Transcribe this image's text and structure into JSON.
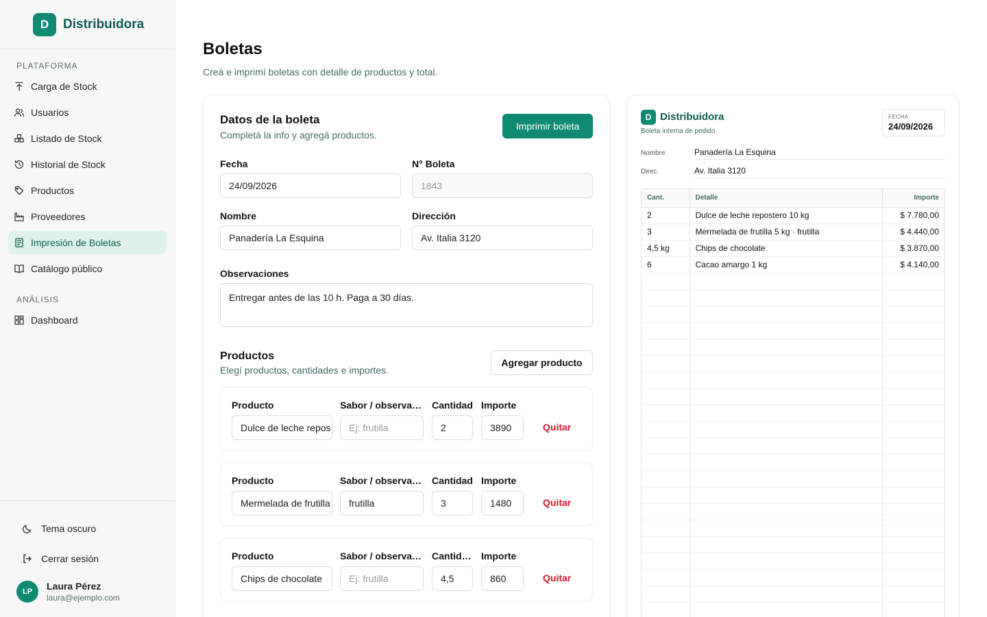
{
  "brand": {
    "initial": "D",
    "name": "Distribuidora"
  },
  "sidebar": {
    "sections": [
      {
        "heading": "PLATAFORMA",
        "items": [
          {
            "label": "Carga de Stock",
            "icon": "upload-icon"
          },
          {
            "label": "Usuarios",
            "icon": "users-icon"
          },
          {
            "label": "Listado de Stock",
            "icon": "boxes-icon"
          },
          {
            "label": "Historial de Stock",
            "icon": "history-icon"
          },
          {
            "label": "Productos",
            "icon": "tag-icon"
          },
          {
            "label": "Proveedores",
            "icon": "factory-icon"
          },
          {
            "label": "Impresión de Boletas",
            "icon": "receipt-icon",
            "active": true
          },
          {
            "label": "Catálogo público",
            "icon": "book-icon"
          }
        ]
      },
      {
        "heading": "ANÁLISIS",
        "items": [
          {
            "label": "Dashboard",
            "icon": "dashboard-icon"
          }
        ]
      }
    ],
    "bottom": {
      "dark_mode": "Tema oscuro",
      "logout": "Cerrar sesión"
    },
    "user": {
      "initials": "LP",
      "name": "Laura Pérez",
      "email": "laura@ejemplo.com"
    }
  },
  "page": {
    "title": "Boletas",
    "subtitle": "Creá e imprimí boletas con detalle de productos y total."
  },
  "form": {
    "title": "Datos de la boleta",
    "subtitle": "Completá la info y agregá productos.",
    "print_button": "Imprimir boleta",
    "fecha_label": "Fecha",
    "fecha_value": "24/09/2026",
    "numero_label": "N° Boleta",
    "numero_value": "1843",
    "nombre_label": "Nombre",
    "nombre_value": "Panadería La Esquina",
    "direccion_label": "Dirección",
    "direccion_value": "Av. Italia 3120",
    "obs_label": "Observaciones",
    "obs_value": "Entregar antes de las 10 h. Paga a 30 días.",
    "products_title": "Productos",
    "products_subtitle": "Elegí productos, cantidades e importes.",
    "add_button": "Agregar producto",
    "rows": [
      {
        "producto_label": "Producto",
        "producto": "Dulce de leche repos",
        "sabor_label": "Sabor / observac...",
        "sabor": "",
        "sabor_placeholder": "Ej: frutilla",
        "cantidad_label": "Cantidad",
        "cantidad": "2",
        "importe_label": "Importe",
        "importe": "3890",
        "remove": "Quitar"
      },
      {
        "producto_label": "Producto",
        "producto": "Mermelada de frutilla",
        "sabor_label": "Sabor / observac...",
        "sabor": "frutilla",
        "sabor_placeholder": "Ej: frutilla",
        "cantidad_label": "Cantidad",
        "cantidad": "3",
        "importe_label": "Importe",
        "importe": "1480",
        "remove": "Quitar"
      },
      {
        "producto_label": "Producto",
        "producto": "Chips de chocolate",
        "sabor_label": "Sabor / observac...",
        "sabor": "",
        "sabor_placeholder": "Ej: frutilla",
        "cantidad_label": "Cantida...",
        "cantidad": "4,5",
        "importe_label": "Importe",
        "importe": "860",
        "remove": "Quitar"
      }
    ]
  },
  "preview": {
    "brand_initial": "D",
    "brand_name": "Distribuidora",
    "subtitle": "Boleta interna de pedido",
    "date_label": "FECHA",
    "date_value": "24/09/2026",
    "nombre_label": "Nombre",
    "nombre_value": "Panadería La Esquina",
    "direccion_label": "Direc.",
    "direccion_value": "Av. Italia 3120",
    "headers": [
      "Cant.",
      "Detalle",
      "Importe"
    ],
    "rows": [
      {
        "cant": "2",
        "detalle": "Dulce de leche repostero 10 kg",
        "importe": "$ 7.780,00"
      },
      {
        "cant": "3",
        "detalle": "Mermelada de frutilla 5 kg · frutilla",
        "importe": "$ 4.440,00"
      },
      {
        "cant": "4,5 kg",
        "detalle": "Chips de chocolate",
        "importe": "$ 3.870,00"
      },
      {
        "cant": "6",
        "detalle": "Cacao amargo 1 kg",
        "importe": "$ 4.140,00"
      }
    ],
    "empty_rows": 21
  },
  "colors": {
    "accent": "#0f8a73",
    "danger": "#d11a2a",
    "active_bg": "#dff3ec"
  }
}
